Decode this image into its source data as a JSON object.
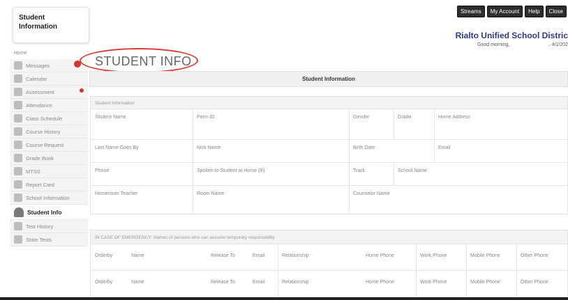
{
  "brand": {
    "line1": "Student",
    "line2": "Information"
  },
  "top_buttons": {
    "streams": "Streams",
    "account": "My Account",
    "help": "Help",
    "close": "Close"
  },
  "district": "Rialto Unified School Distric",
  "greeting": "Good morning,",
  "date": ", 4/1/202",
  "sidebar": {
    "home": "Home",
    "items": [
      {
        "label": "Messages"
      },
      {
        "label": "Calendar"
      },
      {
        "label": "Assessment"
      },
      {
        "label": "Attendance"
      },
      {
        "label": "Class Schedule"
      },
      {
        "label": "Course History"
      },
      {
        "label": "Course Request"
      },
      {
        "label": "Grade Book"
      },
      {
        "label": "MTSS"
      },
      {
        "label": "Report Card"
      },
      {
        "label": "School Information"
      },
      {
        "label": "Student Info"
      },
      {
        "label": "Test History"
      },
      {
        "label": "State Tests"
      }
    ]
  },
  "page_title": "STUDENT INFO",
  "section_bar": "Student Information",
  "info": {
    "header": "Student Information",
    "rows": [
      [
        "Student Name",
        "Perm ID",
        "Gender",
        "Grade",
        "Home Address"
      ],
      [
        "Last Name Goes By",
        "Nick Name",
        "Birth Date",
        "Email"
      ],
      [
        "Phone",
        "Spoken to Student at Home (lll)",
        "Track",
        "School Name"
      ],
      [
        "Homeroom Teacher",
        "Room Name",
        "Counselor Name"
      ]
    ]
  },
  "emergency": {
    "header": "IN CASE OF EMERGENCY: Names of persons who can assume temporary responsibility",
    "rows": [
      [
        "Orderby",
        "Name",
        "Release To",
        "Email",
        "Relationship",
        "Home Phone",
        "Work Phone",
        "Mobile Phone",
        "Other Phone"
      ],
      [
        "Orderby",
        "Name",
        "Release To",
        "Email",
        "Relationship",
        "Home Phone",
        "Work Phone",
        "Mobile Phone",
        "Other Phone"
      ]
    ]
  },
  "colors": {
    "accent": "#d93a31",
    "district": "#2a3b8f"
  }
}
